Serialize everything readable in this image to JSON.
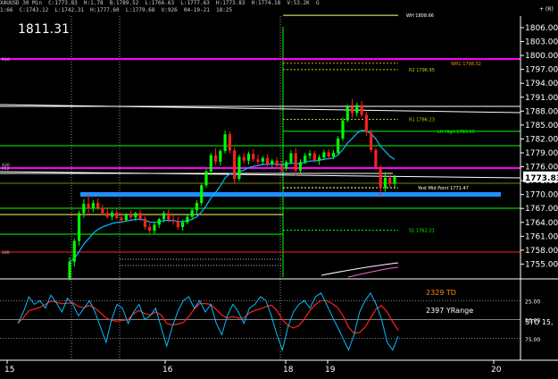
{
  "header": {
    "line1": "XAUUSD 30 Min  C:1773.83  H:1.78  B:1789.52  L:1766.63  L:1777.63  H:1773.83  H:1774.18  V:53.2K  G",
    "line2": "1:66  C:1743.12  L:1742.31  H:1777.60  L:1779.68  V:926  04-19-21  18:25",
    "top_right": "+ (R)"
  },
  "big_price_label": "1811.31",
  "current_price": "1773.83",
  "price_axis": {
    "ticks": [
      "1806.00",
      "1803.00",
      "1800.00",
      "1797.00",
      "1794.00",
      "1791.00",
      "1788.00",
      "1785.00",
      "1782.00",
      "1779.00",
      "1776.00",
      "1773.00",
      "1770.00",
      "1767.00",
      "1764.00",
      "1761.00",
      "1758.00",
      "1755.00"
    ]
  },
  "level_labels": [
    {
      "text": "WH 1808.66",
      "color": "#ffffff"
    },
    {
      "text": "WR1 1798.32",
      "color": "#ff8c00"
    },
    {
      "text": "R2 1796.95",
      "color": "#b7d300"
    },
    {
      "text": "R1 1786.23",
      "color": "#b7d300"
    },
    {
      "text": "LH High 1783.65",
      "color": "#00ff00"
    },
    {
      "text": "Yest Mid Point 1771.47",
      "color": "#ffffff"
    },
    {
      "text": "S1 1762.31",
      "color": "#00ff00"
    }
  ],
  "left_edge_labels": [
    "R10",
    "P22",
    "A20",
    "100"
  ],
  "indicator": {
    "label_td": "2329 TD",
    "label_yrange": "2397 YRange",
    "label_sto": "STO  15,",
    "ticks": [
      "25.00",
      "50.00",
      "75.00"
    ],
    "colors": {
      "sto_k": "#00bfff",
      "sto_d": "#ff2020"
    }
  },
  "time_axis": {
    "labels": [
      "15",
      "16",
      "18",
      "19",
      "20"
    ]
  },
  "colors": {
    "bull": "#00ff00",
    "bear": "#ff2020",
    "magenta": "#ff00ff",
    "blue_band": "#1e90ff",
    "ema": "#00bfff",
    "axis": "#ffffff"
  },
  "chart_data": {
    "type": "candlestick",
    "symbol": "XAUUSD",
    "timeframe": "30 Min",
    "ylim": [
      1752.0,
      1808.5
    ],
    "x_labels": [
      "15",
      "16",
      "18",
      "19",
      "20"
    ],
    "levels": [
      {
        "name": "WH",
        "value": 1808.66
      },
      {
        "name": "WR1",
        "value": 1798.32
      },
      {
        "name": "R2",
        "value": 1796.95
      },
      {
        "name": "R1",
        "value": 1786.23
      },
      {
        "name": "LH High",
        "value": 1783.65
      },
      {
        "name": "Yest Mid Point",
        "value": 1771.47
      },
      {
        "name": "S1",
        "value": 1762.31
      }
    ],
    "candles": [
      {
        "o": 1752.0,
        "h": 1756.5,
        "l": 1751.5,
        "c": 1755.5
      },
      {
        "o": 1755.5,
        "h": 1760.5,
        "l": 1754.5,
        "c": 1760.0
      },
      {
        "o": 1760.0,
        "h": 1766.5,
        "l": 1759.0,
        "c": 1766.0
      },
      {
        "o": 1766.0,
        "h": 1769.0,
        "l": 1765.0,
        "c": 1768.0
      },
      {
        "o": 1768.0,
        "h": 1770.0,
        "l": 1766.0,
        "c": 1767.0
      },
      {
        "o": 1767.0,
        "h": 1768.8,
        "l": 1766.2,
        "c": 1768.2
      },
      {
        "o": 1768.2,
        "h": 1769.2,
        "l": 1766.6,
        "c": 1767.1
      },
      {
        "o": 1767.1,
        "h": 1767.8,
        "l": 1765.5,
        "c": 1766.0
      },
      {
        "o": 1766.0,
        "h": 1767.0,
        "l": 1764.8,
        "c": 1765.2
      },
      {
        "o": 1765.2,
        "h": 1766.6,
        "l": 1764.5,
        "c": 1766.1
      },
      {
        "o": 1766.1,
        "h": 1766.9,
        "l": 1764.6,
        "c": 1765.0
      },
      {
        "o": 1765.0,
        "h": 1766.0,
        "l": 1763.9,
        "c": 1764.5
      },
      {
        "o": 1764.5,
        "h": 1766.0,
        "l": 1764.1,
        "c": 1765.7
      },
      {
        "o": 1765.7,
        "h": 1766.6,
        "l": 1764.6,
        "c": 1765.1
      },
      {
        "o": 1765.1,
        "h": 1766.3,
        "l": 1764.3,
        "c": 1766.0
      },
      {
        "o": 1766.0,
        "h": 1766.8,
        "l": 1764.2,
        "c": 1764.8
      },
      {
        "o": 1764.8,
        "h": 1765.4,
        "l": 1762.4,
        "c": 1763.0
      },
      {
        "o": 1763.0,
        "h": 1763.9,
        "l": 1761.6,
        "c": 1762.2
      },
      {
        "o": 1762.2,
        "h": 1763.9,
        "l": 1761.6,
        "c": 1763.5
      },
      {
        "o": 1763.5,
        "h": 1765.0,
        "l": 1762.8,
        "c": 1764.7
      },
      {
        "o": 1764.7,
        "h": 1766.5,
        "l": 1764.0,
        "c": 1766.0
      },
      {
        "o": 1766.0,
        "h": 1766.8,
        "l": 1764.0,
        "c": 1764.6
      },
      {
        "o": 1764.6,
        "h": 1765.5,
        "l": 1763.5,
        "c": 1764.2
      },
      {
        "o": 1764.2,
        "h": 1765.2,
        "l": 1762.4,
        "c": 1763.0
      },
      {
        "o": 1763.0,
        "h": 1764.6,
        "l": 1762.2,
        "c": 1764.0
      },
      {
        "o": 1764.0,
        "h": 1765.6,
        "l": 1763.6,
        "c": 1765.2
      },
      {
        "o": 1765.2,
        "h": 1767.0,
        "l": 1764.6,
        "c": 1766.6
      },
      {
        "o": 1766.6,
        "h": 1768.8,
        "l": 1765.8,
        "c": 1768.2
      },
      {
        "o": 1768.2,
        "h": 1772.5,
        "l": 1767.6,
        "c": 1772.0
      },
      {
        "o": 1772.0,
        "h": 1775.6,
        "l": 1771.4,
        "c": 1775.0
      },
      {
        "o": 1775.0,
        "h": 1779.0,
        "l": 1774.2,
        "c": 1778.5
      },
      {
        "o": 1778.5,
        "h": 1780.0,
        "l": 1776.4,
        "c": 1777.1
      },
      {
        "o": 1777.1,
        "h": 1779.8,
        "l": 1776.2,
        "c": 1779.4
      },
      {
        "o": 1779.4,
        "h": 1783.8,
        "l": 1778.9,
        "c": 1783.0
      },
      {
        "o": 1783.0,
        "h": 1783.6,
        "l": 1778.9,
        "c": 1779.5
      },
      {
        "o": 1779.5,
        "h": 1780.2,
        "l": 1772.4,
        "c": 1773.4
      },
      {
        "o": 1773.4,
        "h": 1778.6,
        "l": 1772.9,
        "c": 1778.1
      },
      {
        "o": 1778.1,
        "h": 1779.0,
        "l": 1776.7,
        "c": 1777.3
      },
      {
        "o": 1777.3,
        "h": 1779.3,
        "l": 1776.5,
        "c": 1778.8
      },
      {
        "o": 1778.8,
        "h": 1779.8,
        "l": 1777.1,
        "c": 1777.6
      },
      {
        "o": 1777.6,
        "h": 1778.7,
        "l": 1776.3,
        "c": 1777.1
      },
      {
        "o": 1777.1,
        "h": 1778.3,
        "l": 1776.3,
        "c": 1777.9
      },
      {
        "o": 1777.9,
        "h": 1778.7,
        "l": 1776.0,
        "c": 1776.6
      },
      {
        "o": 1776.6,
        "h": 1777.7,
        "l": 1775.7,
        "c": 1777.3
      },
      {
        "o": 1777.3,
        "h": 1778.0,
        "l": 1775.8,
        "c": 1776.2
      },
      {
        "o": 1776.2,
        "h": 1777.3,
        "l": 1774.9,
        "c": 1775.6
      },
      {
        "o": 1775.6,
        "h": 1777.4,
        "l": 1775.1,
        "c": 1777.0
      },
      {
        "o": 1777.0,
        "h": 1779.6,
        "l": 1776.4,
        "c": 1778.9
      },
      {
        "o": 1778.9,
        "h": 1780.1,
        "l": 1774.1,
        "c": 1775.2
      },
      {
        "o": 1775.2,
        "h": 1777.6,
        "l": 1774.6,
        "c": 1777.0
      },
      {
        "o": 1777.0,
        "h": 1779.0,
        "l": 1776.6,
        "c": 1778.4
      },
      {
        "o": 1778.4,
        "h": 1779.6,
        "l": 1777.7,
        "c": 1778.9
      },
      {
        "o": 1778.9,
        "h": 1779.4,
        "l": 1776.9,
        "c": 1777.4
      },
      {
        "o": 1777.4,
        "h": 1778.6,
        "l": 1776.4,
        "c": 1778.0
      },
      {
        "o": 1778.0,
        "h": 1779.7,
        "l": 1777.4,
        "c": 1779.1
      },
      {
        "o": 1779.1,
        "h": 1779.8,
        "l": 1777.6,
        "c": 1778.2
      },
      {
        "o": 1778.2,
        "h": 1779.6,
        "l": 1777.6,
        "c": 1779.0
      },
      {
        "o": 1779.0,
        "h": 1782.6,
        "l": 1778.5,
        "c": 1782.1
      },
      {
        "o": 1782.1,
        "h": 1786.6,
        "l": 1781.6,
        "c": 1786.0
      },
      {
        "o": 1786.0,
        "h": 1789.4,
        "l": 1785.6,
        "c": 1788.9
      },
      {
        "o": 1788.9,
        "h": 1790.6,
        "l": 1786.6,
        "c": 1787.6
      },
      {
        "o": 1787.6,
        "h": 1789.8,
        "l": 1786.8,
        "c": 1789.3
      },
      {
        "o": 1789.3,
        "h": 1790.2,
        "l": 1786.7,
        "c": 1787.2
      },
      {
        "o": 1787.2,
        "h": 1787.9,
        "l": 1782.7,
        "c": 1783.4
      },
      {
        "o": 1783.4,
        "h": 1784.0,
        "l": 1779.1,
        "c": 1779.6
      },
      {
        "o": 1779.6,
        "h": 1780.1,
        "l": 1775.4,
        "c": 1775.9
      },
      {
        "o": 1775.9,
        "h": 1776.4,
        "l": 1769.4,
        "c": 1771.4
      },
      {
        "o": 1771.4,
        "h": 1774.8,
        "l": 1770.6,
        "c": 1773.6
      },
      {
        "o": 1773.6,
        "h": 1774.2,
        "l": 1771.6,
        "c": 1772.3
      },
      {
        "o": 1772.3,
        "h": 1774.3,
        "l": 1771.6,
        "c": 1773.8
      }
    ]
  }
}
